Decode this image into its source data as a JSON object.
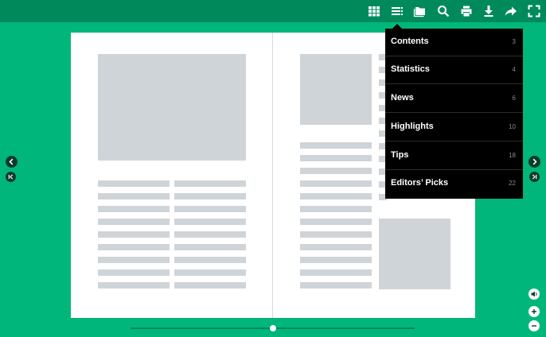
{
  "toolbar": {
    "icons": [
      "thumbnails-grid-icon",
      "table-of-contents-icon",
      "folder-icon",
      "search-icon",
      "print-icon",
      "download-icon",
      "share-icon",
      "fullscreen-icon"
    ]
  },
  "toc_menu": {
    "items": [
      {
        "label": "Contents",
        "page": "3"
      },
      {
        "label": "Statistics",
        "page": "4"
      },
      {
        "label": "News",
        "page": "6"
      },
      {
        "label": "Highlights",
        "page": "10"
      },
      {
        "label": "Tips",
        "page": "18"
      },
      {
        "label": "Editors’ Picks",
        "page": "22"
      }
    ]
  },
  "colors": {
    "background": "#00b67a",
    "toolbar": "#008a5c",
    "menu": "#000000",
    "placeholder": "#cfd4d8"
  },
  "navigation": {
    "icons": [
      "previous-page-icon",
      "first-page-icon",
      "next-page-icon",
      "last-page-icon"
    ]
  },
  "zoom_controls": {
    "icons": [
      "sound-icon",
      "zoom-in-icon",
      "zoom-out-icon"
    ]
  },
  "page_slider": {
    "position_fraction": 0.5
  }
}
